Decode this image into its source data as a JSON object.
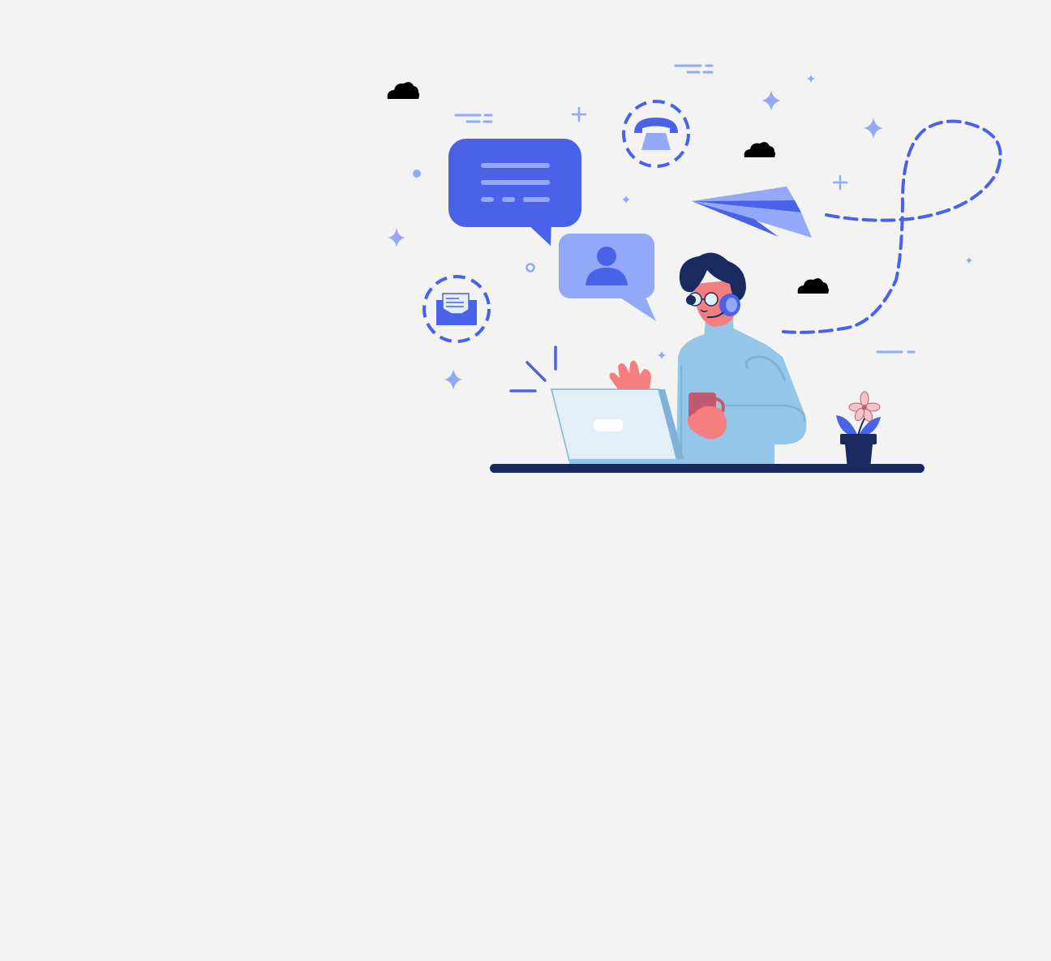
{
  "scene": {
    "background": "#f3f3f3",
    "colors": {
      "primary": "#4a62e8",
      "light": "#93a8f6",
      "navy": "#1b2a5e",
      "skin": "#f57f7f",
      "shirt": "#93c6e8",
      "laptop": "#e3eff7",
      "mug": "#c05a6e",
      "petal": "#f8c3c9",
      "cloud": "#000000"
    },
    "icons": [
      "message-bubble-icon",
      "contact-bubble-icon",
      "phone-icon",
      "mail-icon",
      "paper-plane-icon",
      "cloud-icon",
      "sparkle-icon",
      "flower-pot-icon",
      "laptop-icon",
      "mug-icon",
      "headset-icon"
    ]
  }
}
